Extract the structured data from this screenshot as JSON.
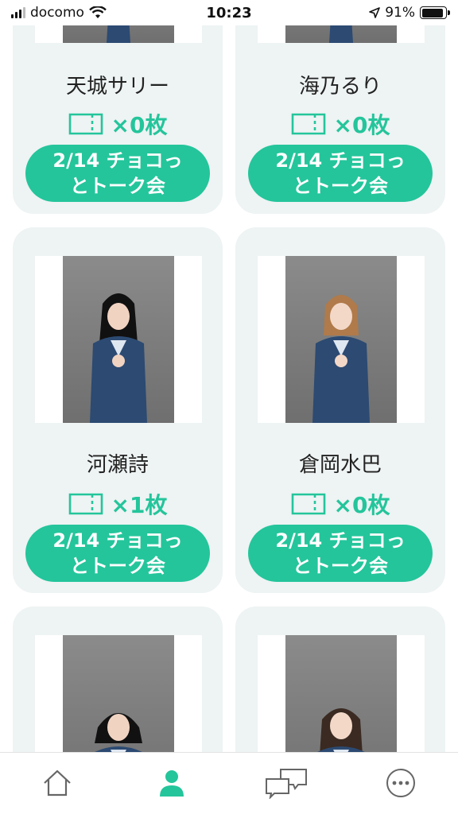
{
  "status_bar": {
    "carrier": "docomo",
    "time": "10:23",
    "battery": "91%"
  },
  "cards": [
    {
      "name": "天城サリー",
      "count": "×0枚",
      "button": "2/14 チョコっ\nとトーク会"
    },
    {
      "name": "海乃るり",
      "count": "×0枚",
      "button": "2/14 チョコっ\nとトーク会"
    },
    {
      "name": "河瀬詩",
      "count": "×1枚",
      "button": "2/14 チョコっ\nとトーク会"
    },
    {
      "name": "倉岡水巴",
      "count": "×0枚",
      "button": "2/14 チョコっ\nとトーク会"
    }
  ],
  "tabs": [
    {
      "icon": "home-icon"
    },
    {
      "icon": "person-icon"
    },
    {
      "icon": "chat-icon"
    },
    {
      "icon": "more-icon"
    }
  ],
  "colors": {
    "accent": "#24c59b",
    "card_bg": "#eef3f3"
  }
}
